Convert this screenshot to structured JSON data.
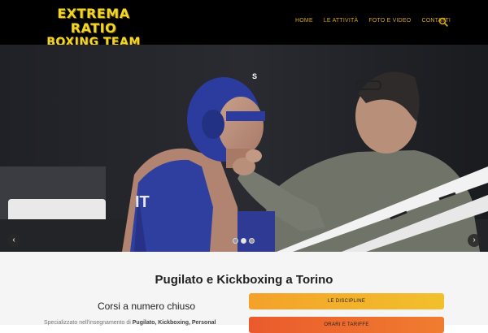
{
  "header": {
    "logo_line1": "EXTREMA RATIO",
    "logo_line2": "BOXING TEAM",
    "nav": [
      "HOME",
      "LE ATTIVITÀ",
      "FOTO E VIDEO",
      "CONTATTI"
    ],
    "search_icon": "search-icon",
    "nav_color": "#d6a51f",
    "logo_color": "#f1d62a"
  },
  "slider": {
    "prev_label": "‹",
    "next_label": "›",
    "dots_count": 3,
    "active_dot": 1,
    "headgear_text": "S"
  },
  "main": {
    "title": "Pugilato e Kickboxing a Torino",
    "subtitle": "Corsi a numero chiuso",
    "description_prefix": "Specializzato nell'insegnamento di ",
    "description_bold": "Pugilato, Kickboxing, Personal",
    "button1_label": "LE DISCIPLINE",
    "button2_label": "ORARI E TARIFFE",
    "button1_color": "#f4a12a",
    "button2_color": "#ea5a2d"
  }
}
